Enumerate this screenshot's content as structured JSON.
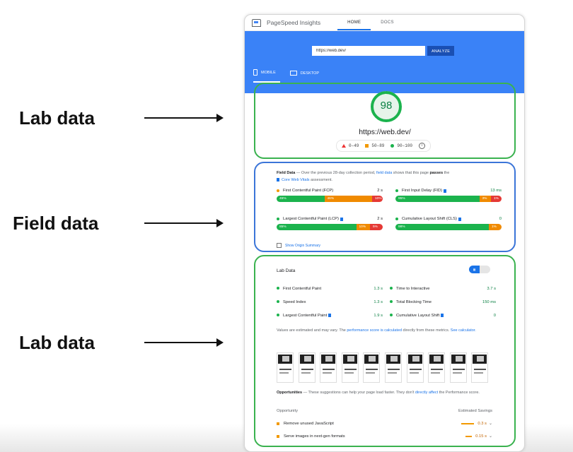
{
  "annotations": [
    "Lab data",
    "Field data",
    "Lab data"
  ],
  "app": {
    "title": "PageSpeed Insights",
    "nav": [
      "HOME",
      "DOCS"
    ]
  },
  "search": {
    "value": "https://web.dev/",
    "button": "ANALYZE"
  },
  "device_tabs": [
    "MOBILE",
    "DESKTOP"
  ],
  "score": {
    "value": "98",
    "fraction": 0.98,
    "url": "https://web.dev/",
    "legend": [
      "0–49",
      "50–89",
      "90–100"
    ],
    "colors": {
      "poor": "#e53935",
      "average": "#f29900",
      "good": "#1bb34d"
    }
  },
  "field": {
    "title": "Field Data",
    "desc_1": " — Over the previous 28-day collection period, ",
    "desc_link": "field data",
    "desc_2": " shows that this page ",
    "desc_bold": "passes",
    "desc_3": " the",
    "cwv_label": "Core Web Vitals",
    "desc_4": " assessment.",
    "metrics": [
      {
        "name": "First Contentful Paint (FCP)",
        "value": "2 s",
        "status": "average",
        "segments": [
          "45%",
          "46%",
          "10%"
        ],
        "fractions": [
          0.45,
          0.45,
          0.1
        ]
      },
      {
        "name": "First Input Delay (FID)",
        "value": "13 ms",
        "status": "good",
        "segments": [
          "95%",
          "3%",
          "1%"
        ],
        "fractions": [
          0.79,
          0.11,
          0.1
        ]
      },
      {
        "name": "Largest Contentful Paint (LCP)",
        "value": "2 s",
        "status": "good",
        "segments": [
          "85%",
          "10%",
          "5%"
        ],
        "fractions": [
          0.75,
          0.13,
          0.12
        ]
      },
      {
        "name": "Cumulative Layout Shift (CLS)",
        "value": "0",
        "status": "good",
        "segments": [
          "98%",
          "1%"
        ],
        "fractions": [
          0.88,
          0.12
        ]
      }
    ],
    "origin_summary": "Show Origin Summary"
  },
  "lab": {
    "title": "Lab Data",
    "metrics": [
      {
        "name": "First Contentful Paint",
        "value": "1.3 s"
      },
      {
        "name": "Time to Interactive",
        "value": "3.7 s"
      },
      {
        "name": "Speed Index",
        "value": "1.3 s"
      },
      {
        "name": "Total Blocking Time",
        "value": "150 ms"
      },
      {
        "name": "Largest Contentful Paint",
        "value": "1.9 s"
      },
      {
        "name": "Cumulative Layout Shift",
        "value": "0"
      }
    ],
    "note_1": "Values are estimated and may vary. The ",
    "note_link": "performance score is calculated",
    "note_2": " directly from these metrics. ",
    "note_link2": "See calculator."
  },
  "opportunities": {
    "title": "Opportunities",
    "desc_1": " — These suggestions can help your page load faster. They don't ",
    "desc_link": "directly affect",
    "desc_2": " the Performance score.",
    "col_left": "Opportunity",
    "col_right": "Estimated Savings",
    "items": [
      {
        "name": "Remove unused JavaScript",
        "saving": "0.3 s",
        "fraction": 0.9
      },
      {
        "name": "Serve images in next-gen formats",
        "saving": "0.15 s",
        "fraction": 0.45
      }
    ]
  }
}
